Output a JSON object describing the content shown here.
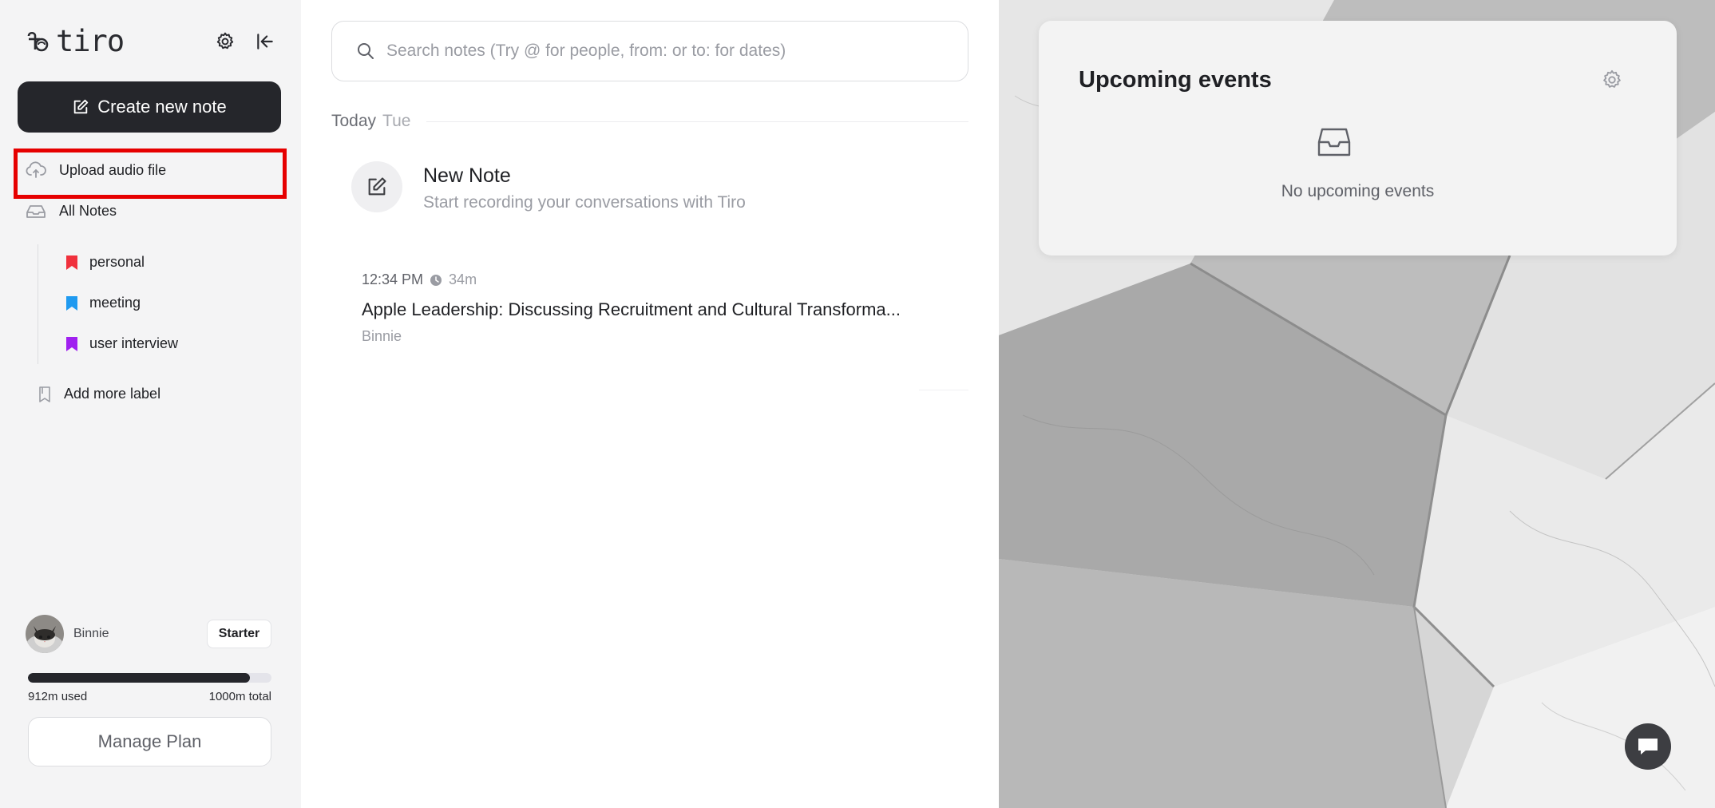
{
  "app": {
    "logo_text": "tiro"
  },
  "sidebar": {
    "create_label": "Create new note",
    "upload_label": "Upload audio file",
    "all_notes_label": "All Notes",
    "labels": [
      {
        "name": "personal",
        "color": "#f0303c"
      },
      {
        "name": "meeting",
        "color": "#1f9af0"
      },
      {
        "name": "user interview",
        "color": "#a020f0"
      }
    ],
    "add_label": "Add more label",
    "user": {
      "name": "Binnie",
      "plan": "Starter"
    },
    "usage": {
      "used_text": "912m used",
      "total_text": "1000m total",
      "used_minutes": 912,
      "total_minutes": 1000
    },
    "manage_plan_label": "Manage Plan"
  },
  "notes": {
    "search_placeholder": "Search notes (Try @ for people, from: or to: for dates)",
    "day_label": "Today",
    "day_name": "Tue",
    "new_note": {
      "title": "New Note",
      "subtitle": "Start recording your conversations with Tiro"
    },
    "items": [
      {
        "time": "12:34 PM",
        "duration": "34m",
        "title": "Apple Leadership: Discussing Recruitment and Cultural Transforma...",
        "author": "Binnie"
      }
    ]
  },
  "events": {
    "title": "Upcoming events",
    "empty_text": "No upcoming events"
  }
}
